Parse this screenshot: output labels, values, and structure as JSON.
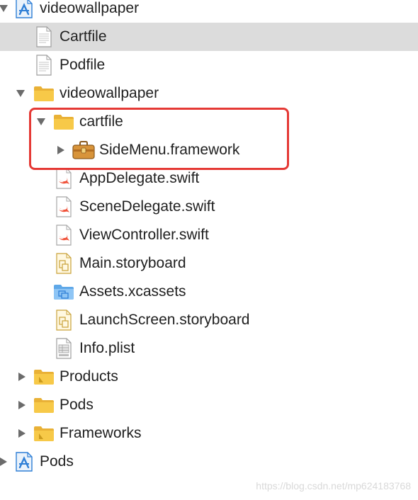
{
  "navigator": {
    "items": [
      {
        "label": "videowallpaper",
        "icon": "xcode-project-icon",
        "expanded": true
      },
      {
        "label": "Cartfile",
        "icon": "text-file-icon",
        "selected": true
      },
      {
        "label": "Podfile",
        "icon": "text-file-icon"
      },
      {
        "label": "videowallpaper",
        "icon": "folder-icon",
        "expanded": true
      },
      {
        "label": "cartfile",
        "icon": "folder-icon",
        "expanded": true
      },
      {
        "label": "SideMenu.framework",
        "icon": "framework-toolbox-icon",
        "expanded": false
      },
      {
        "label": "AppDelegate.swift",
        "icon": "swift-file-icon"
      },
      {
        "label": "SceneDelegate.swift",
        "icon": "swift-file-icon"
      },
      {
        "label": "ViewController.swift",
        "icon": "swift-file-icon"
      },
      {
        "label": "Main.storyboard",
        "icon": "storyboard-file-icon"
      },
      {
        "label": "Assets.xcassets",
        "icon": "asset-catalog-icon"
      },
      {
        "label": "LaunchScreen.storyboard",
        "icon": "storyboard-file-icon"
      },
      {
        "label": "Info.plist",
        "icon": "plist-file-icon"
      },
      {
        "label": "Products",
        "icon": "products-folder-icon",
        "expanded": false
      },
      {
        "label": "Pods",
        "icon": "folder-icon",
        "expanded": false
      },
      {
        "label": "Frameworks",
        "icon": "products-folder-icon",
        "expanded": false
      },
      {
        "label": "Pods",
        "icon": "xcode-project-icon",
        "expanded": false
      }
    ]
  },
  "annotation": {
    "highlight_color": "#e53935"
  },
  "watermark": {
    "text": "https://blog.csdn.net/mp624183768"
  },
  "colors": {
    "selected_row": "#dcdcdc",
    "folder": "#f5c242",
    "swift": "#f05138",
    "project": "#2f7fd6"
  }
}
